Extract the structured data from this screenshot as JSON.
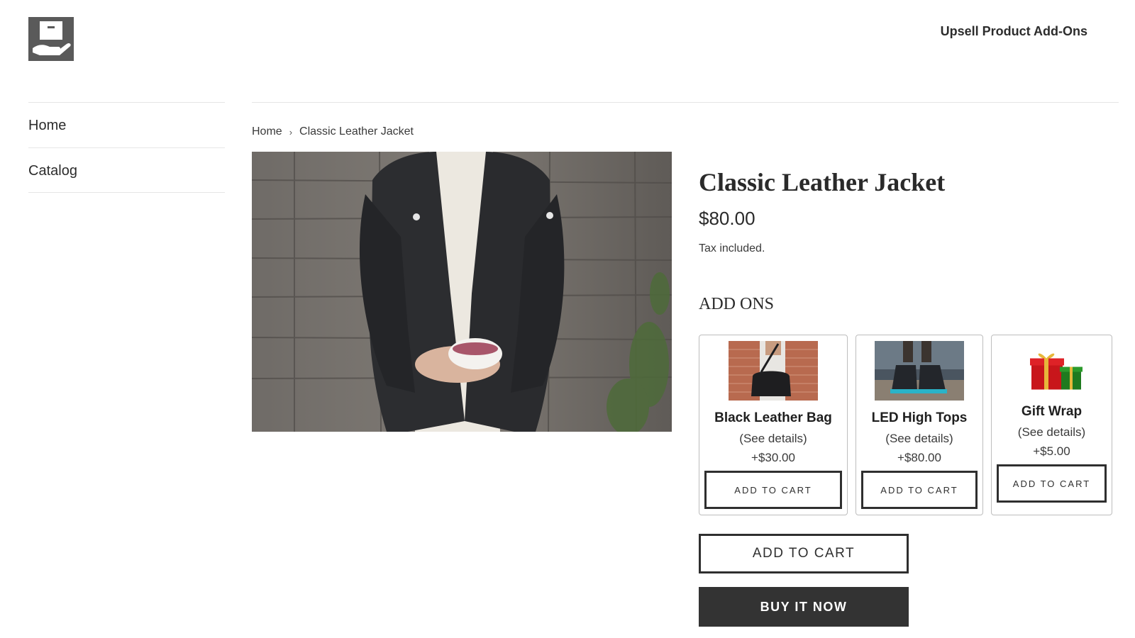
{
  "header": {
    "store_name": "Upsell Product Add-Ons",
    "logo_icon": "box-in-hand-icon"
  },
  "sidebar": {
    "items": [
      {
        "label": "Home"
      },
      {
        "label": "Catalog"
      }
    ]
  },
  "breadcrumb": {
    "home": "Home",
    "separator": "›",
    "current": "Classic Leather Jacket"
  },
  "product": {
    "title": "Classic Leather Jacket",
    "price": "$80.00",
    "tax_note": "Tax included.",
    "image": "leather-jacket-photo"
  },
  "addons": {
    "heading": "ADD ONS",
    "items": [
      {
        "name": "Black Leather Bag",
        "details": "(See details)",
        "price": "+$30.00",
        "button": "ADD TO CART",
        "image": "leather-bag-photo"
      },
      {
        "name": "LED High Tops",
        "details": "(See details)",
        "price": "+$80.00",
        "button": "ADD TO CART",
        "image": "high-tops-photo"
      },
      {
        "name": "Gift Wrap",
        "details": "(See details)",
        "price": "+$5.00",
        "button": "ADD TO CART",
        "image": "gift-box-icon"
      }
    ]
  },
  "actions": {
    "add_to_cart": "ADD TO CART",
    "buy_now": "BUY IT NOW"
  },
  "colors": {
    "accent_dark": "#333333",
    "border": "#e6e6e6",
    "text": "#3a3a3a"
  }
}
